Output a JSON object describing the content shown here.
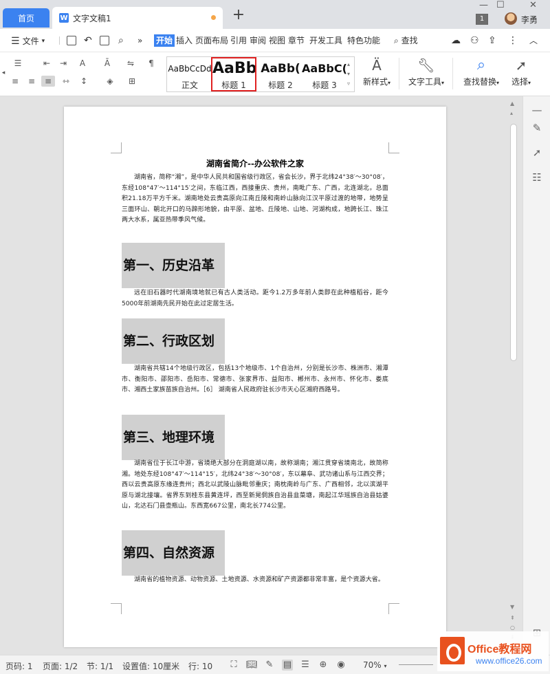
{
  "titlebar": {
    "home_tab": "首页",
    "doc_tab": "文字文稿1",
    "doc_icon": "W",
    "add_tab": "+",
    "badge": "1",
    "username": "李勇"
  },
  "menubar": {
    "file": "文件",
    "more": "»",
    "items": [
      "开始",
      "插入",
      "页面布局",
      "引用",
      "审阅",
      "视图",
      "章节",
      "开发工具",
      "特色功能"
    ],
    "search": "查找"
  },
  "ribbon": {
    "styles": [
      {
        "preview": "AaBbCcDd",
        "label": "正文"
      },
      {
        "preview": "AaBb",
        "label": "标题 1"
      },
      {
        "preview": "AaBb(",
        "label": "标题 2"
      },
      {
        "preview": "AaBbC(",
        "label": "标题 3"
      }
    ],
    "new_style": "新样式",
    "text_tools": "文字工具",
    "find_replace": "查找替换",
    "select": "选择"
  },
  "document": {
    "title": "湖南省简介--办公软件之家",
    "intro": "湖南省，简称“湘”，是中华人民共和国省级行政区，省会长沙，界于北纬24°38′～30°08′，东经108°47′～114°15′之间，东临江西，西接重庆、贵州，南毗广东、广西，北连湖北，总面积21.18万平方千米。湖南地处云贵高原向江南丘陵和南岭山脉向江汉平原过渡的地带，地势呈三面环山、朝北开口的马蹄形地貌，由平原、盆地、丘陵地、山地、河湖构成，地跨长江、珠江两大水系，属亚热带季风气候。",
    "sections": [
      {
        "heading": "第一、历史沿革",
        "text": "远在旧石器时代湖南境地就已有古人类活动。距今1.2万多年前人类即在此种植稻谷，距今5000年前湖南先民开始在此过定居生活。"
      },
      {
        "heading": "第二、行政区划",
        "text": "湖南省共辖14个地级行政区，包括13个地级市、1个自治州，分别是长沙市、株洲市、湘潭市、衡阳市、邵阳市、岳阳市、常德市、张家界市、益阳市、郴州市、永州市、怀化市、娄底市、湘西土家族苗族自治州。［6］ 湖南省人民政府驻长沙市天心区湘府西路号。"
      },
      {
        "heading": "第三、地理环境",
        "text": "湖南省位于长江中游，省境绝大部分在洞庭湖以南，故称湖南；湘江贯穿省境南北，故简称湘。地处东经108°47′～114°15′，北纬24°38′～30°08′，东以幕阜、武功诸山系与江西交界；西以云贵高原东缘连贵州；西北以武陵山脉毗邻重庆；南枕南岭与广东、广西相邻，北以滨湖平原与湖北接壤。省界东到桂东县黄连坪，西至新晃侗族自治县韭菜塘，南起江华瑶族自治县姑婆山，北达石门县壶瓶山。东西宽667公里，南北长774公里。"
      },
      {
        "heading": "第四、自然资源",
        "text": "湖南省的植物资源、动物资源、土地资源、水资源和矿产资源都非常丰富，是个资源大省。"
      }
    ]
  },
  "statusbar": {
    "page_num": "页码: 1",
    "pages": "页面: 1/2",
    "section": "节: 1/1",
    "setting": "设置值: 10厘米",
    "row": "行: 10",
    "zoom": "70%"
  },
  "watermark": {
    "brand": "Office教程网",
    "url": "www.office26.com"
  }
}
